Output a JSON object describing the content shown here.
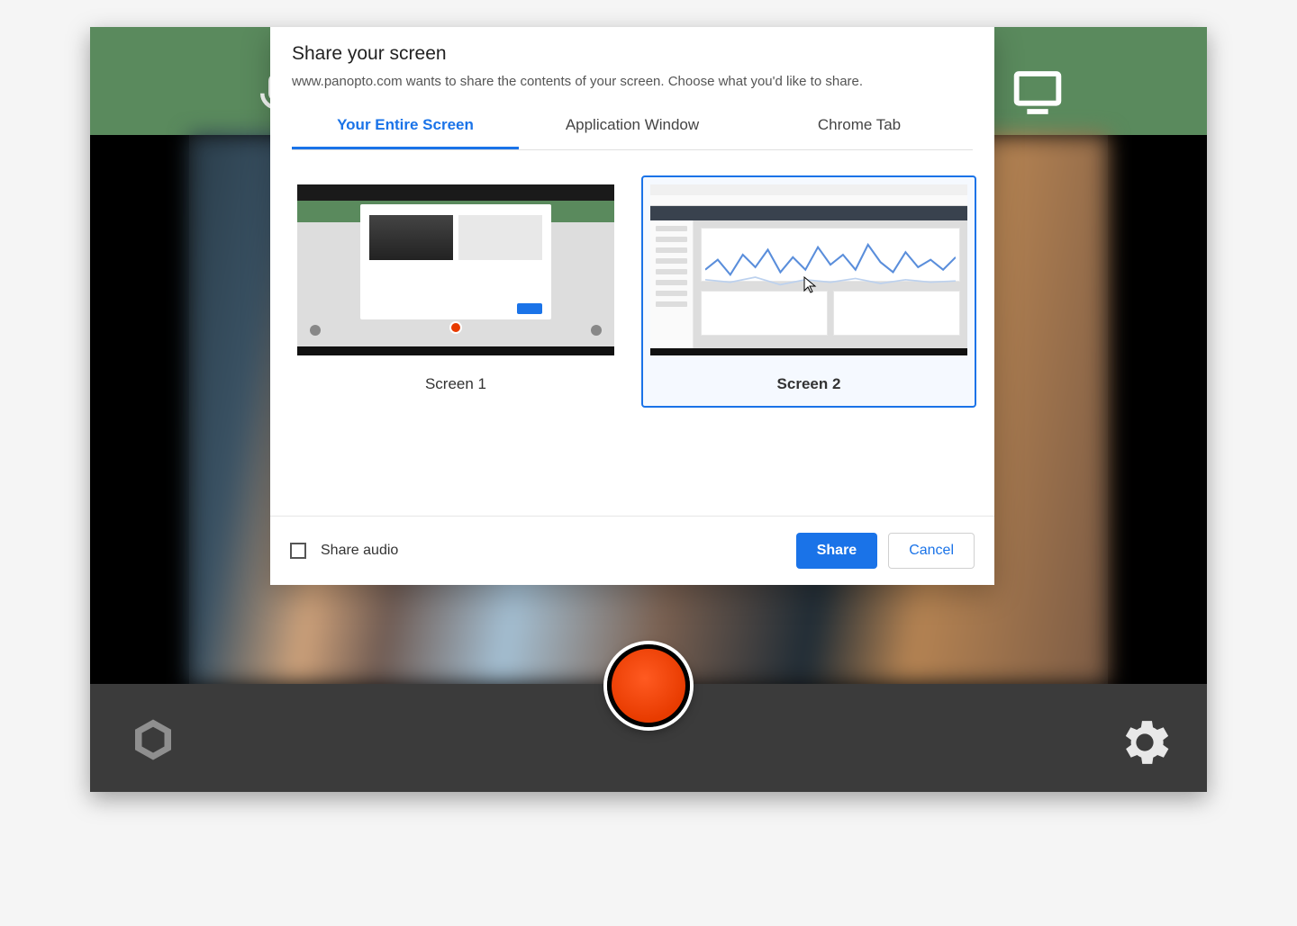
{
  "dialog": {
    "title": "Share your screen",
    "description": "www.panopto.com wants to share the contents of your screen. Choose what you'd like to share.",
    "tabs": {
      "entire": "Your Entire Screen",
      "window": "Application Window",
      "tab": "Chrome Tab"
    },
    "screens": {
      "s1": "Screen 1",
      "s2": "Screen 2"
    },
    "share_audio": "Share audio",
    "buttons": {
      "share": "Share",
      "cancel": "Cancel"
    }
  }
}
